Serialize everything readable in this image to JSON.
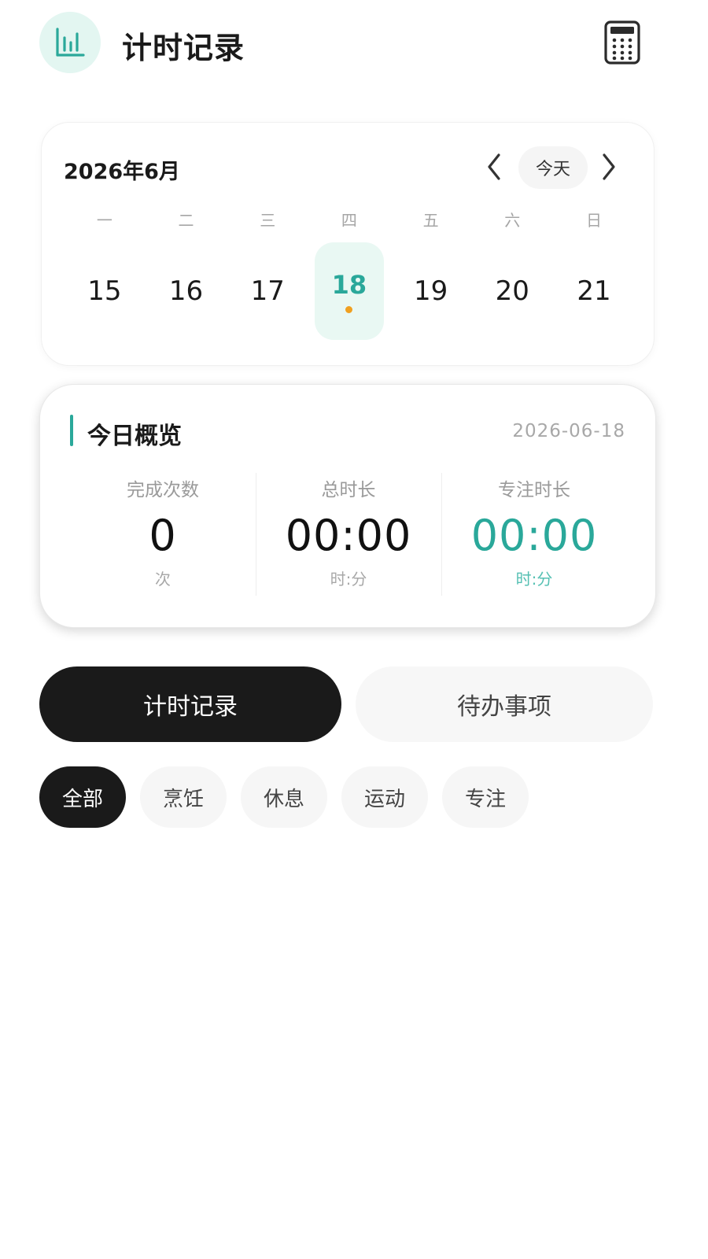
{
  "header": {
    "title": "计时记录",
    "logo_icon": "bar-chart-icon",
    "action_icon": "calculator-icon"
  },
  "calendar": {
    "month_label": "2026年6月",
    "today_button": "今天",
    "weekdays": [
      "一",
      "二",
      "三",
      "四",
      "五",
      "六",
      "日"
    ],
    "days": [
      "15",
      "16",
      "17",
      "18",
      "19",
      "20",
      "21"
    ],
    "selected_day": "18"
  },
  "overview": {
    "title": "今日概览",
    "date": "2026-06-18",
    "stats": [
      {
        "label": "完成次数",
        "value": "0",
        "unit": "次"
      },
      {
        "label": "总时长",
        "value": "00:00",
        "unit": "时:分"
      },
      {
        "label": "专注时长",
        "value": "00:00",
        "unit": "时:分"
      }
    ]
  },
  "tabs": [
    {
      "label": "计时记录",
      "active": true
    },
    {
      "label": "待办事项",
      "active": false
    }
  ],
  "filters": [
    {
      "label": "全部",
      "active": true
    },
    {
      "label": "烹饪",
      "active": false
    },
    {
      "label": "休息",
      "active": false
    },
    {
      "label": "运动",
      "active": false
    },
    {
      "label": "专注",
      "active": false
    }
  ],
  "colors": {
    "accent": "#2aa89a",
    "dot": "#f0a020",
    "dark": "#1a1a1a"
  }
}
